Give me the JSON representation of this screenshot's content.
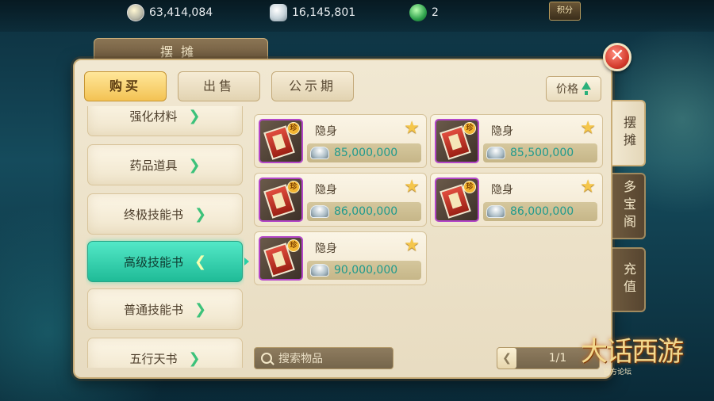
{
  "currency": {
    "coins": "63,414,084",
    "silver": "16,145,801",
    "jade": "2",
    "top_button": "积分"
  },
  "panel": {
    "title": "摆摊",
    "tabs": [
      "购买",
      "出售",
      "公示期"
    ],
    "active_tab": 0,
    "sort_label": "价格",
    "search_placeholder": "搜索物品",
    "pager": "1/1"
  },
  "categories": [
    {
      "label": "强化材料"
    },
    {
      "label": "药品道具"
    },
    {
      "label": "终极技能书"
    },
    {
      "label": "高级技能书"
    },
    {
      "label": "普通技能书"
    },
    {
      "label": "五行天书"
    }
  ],
  "active_category": 3,
  "items": [
    {
      "name": "隐身",
      "price": "85,000,000",
      "badge": "珍"
    },
    {
      "name": "隐身",
      "price": "85,500,000",
      "badge": "珍"
    },
    {
      "name": "隐身",
      "price": "86,000,000",
      "badge": "珍"
    },
    {
      "name": "隐身",
      "price": "86,000,000",
      "badge": "珍"
    },
    {
      "name": "隐身",
      "price": "90,000,000",
      "badge": "珍"
    }
  ],
  "side_tabs": [
    "摆摊",
    "多宝阁",
    "充值"
  ],
  "logo": {
    "title": "大话西游",
    "sub": "官方论坛"
  },
  "colors": {
    "accent": "#1fbb97",
    "price": "#1f9a8d",
    "tab_active": "#f3c253",
    "close": "#d2392b"
  }
}
